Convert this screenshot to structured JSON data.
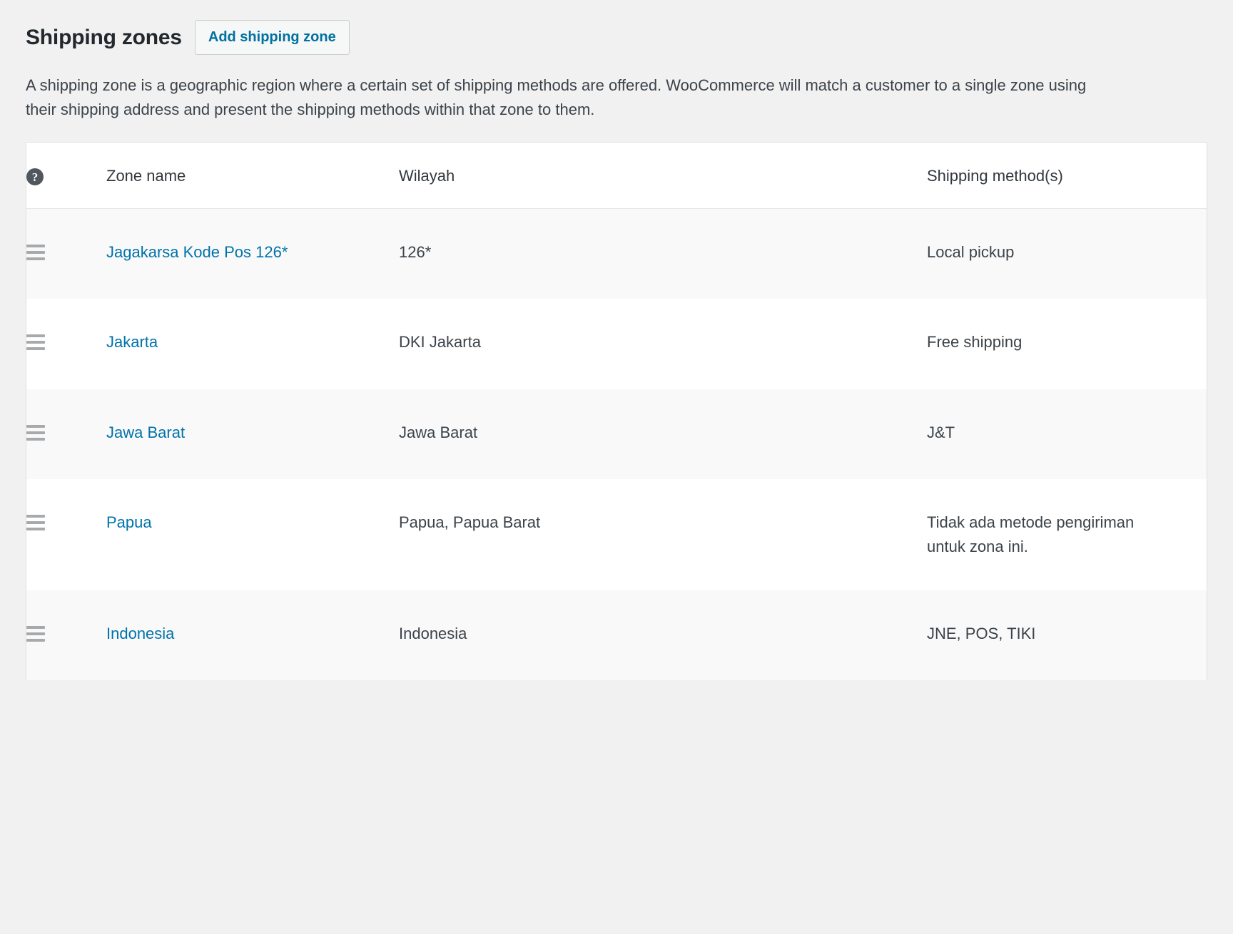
{
  "header": {
    "title": "Shipping zones",
    "add_button_label": "Add shipping zone"
  },
  "description": "A shipping zone is a geographic region where a certain set of shipping methods are offered. WooCommerce will match a customer to a single zone using their shipping address and present the shipping methods within that zone to them.",
  "table": {
    "columns": {
      "help": "?",
      "zone_name": "Zone name",
      "region": "Wilayah",
      "shipping_methods": "Shipping method(s)"
    },
    "rows": [
      {
        "zone_name": "Jagakarsa Kode Pos 126*",
        "region": "126*",
        "shipping_methods": "Local pickup"
      },
      {
        "zone_name": "Jakarta",
        "region": "DKI Jakarta",
        "shipping_methods": "Free shipping"
      },
      {
        "zone_name": "Jawa Barat",
        "region": "Jawa Barat",
        "shipping_methods": "J&T"
      },
      {
        "zone_name": "Papua",
        "region": "Papua, Papua Barat",
        "shipping_methods": "Tidak ada metode pengiriman untuk zona ini."
      },
      {
        "zone_name": "Indonesia",
        "region": "Indonesia",
        "shipping_methods": "JNE, POS, TIKI"
      }
    ]
  },
  "colors": {
    "link": "#0073aa",
    "page_background": "#f1f1f1",
    "row_alt_background": "#f9f9f9",
    "text": "#3c434a",
    "handle": "#a7aaad"
  }
}
